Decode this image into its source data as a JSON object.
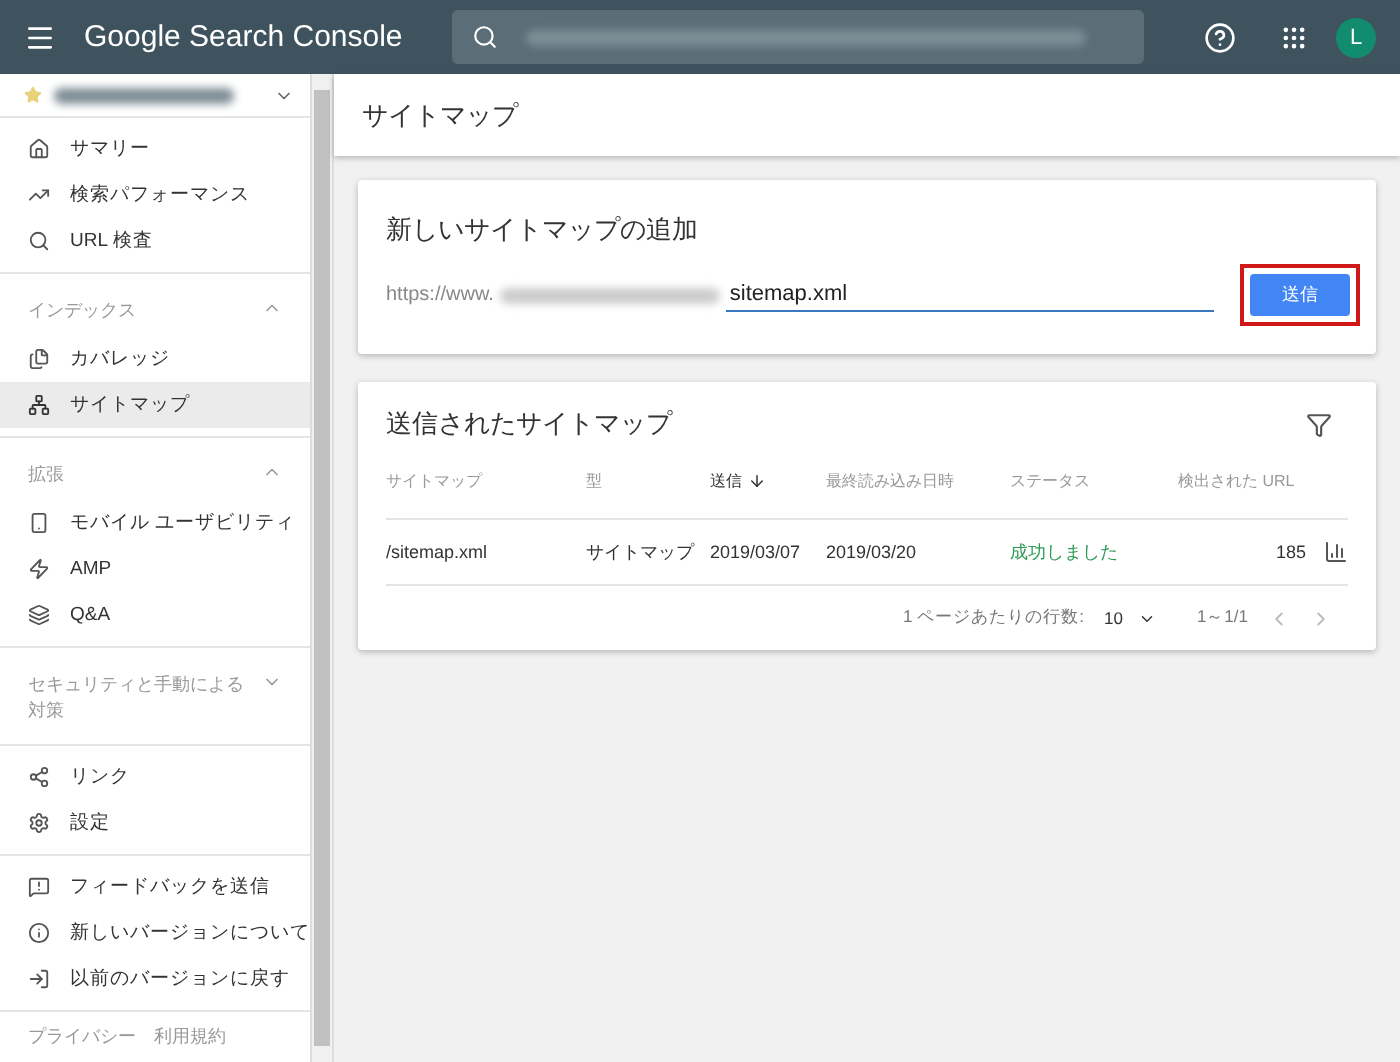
{
  "header": {
    "product": "Google Search Console",
    "avatar_letter": "L"
  },
  "page_title": "サイトマップ",
  "sidebar": {
    "groups": [
      {
        "items": [
          {
            "label": "サマリー",
            "selected": false
          },
          {
            "label": "検索パフォーマンス",
            "selected": false
          },
          {
            "label": "URL 検査",
            "selected": false
          }
        ]
      },
      {
        "title": "インデックス",
        "expanded": true,
        "items": [
          {
            "label": "カバレッジ",
            "selected": false
          },
          {
            "label": "サイトマップ",
            "selected": true
          }
        ]
      },
      {
        "title": "拡張",
        "expanded": true,
        "items": [
          {
            "label": "モバイル ユーザビリティ",
            "selected": false
          },
          {
            "label": "AMP",
            "selected": false
          },
          {
            "label": "Q&A",
            "selected": false
          }
        ]
      },
      {
        "title": "セキュリティと手動による対策",
        "expanded": false
      },
      {
        "items": [
          {
            "label": "リンク",
            "selected": false
          },
          {
            "label": "設定",
            "selected": false
          }
        ]
      },
      {
        "items": [
          {
            "label": "フィードバックを送信",
            "selected": false
          },
          {
            "label": "新しいバージョンについて",
            "selected": false
          },
          {
            "label": "以前のバージョンに戻す",
            "selected": false
          }
        ]
      }
    ],
    "footer": "プライバシー　利用規約"
  },
  "add_card": {
    "title": "新しいサイトマップの追加",
    "url_prefix": "https://www.",
    "value": "sitemap.xml",
    "submit": "送信"
  },
  "list_card": {
    "title": "送信されたサイトマップ",
    "columns": [
      {
        "label": "サイトマップ",
        "sorted": false
      },
      {
        "label": "型",
        "sorted": false
      },
      {
        "label": "送信",
        "sorted": true
      },
      {
        "label": "最終読み込み日時",
        "sorted": false
      },
      {
        "label": "ステータス",
        "sorted": false
      },
      {
        "label": "検出された URL",
        "sorted": false
      }
    ],
    "rows": [
      {
        "sitemap": "/sitemap.xml",
        "type": "サイトマップ",
        "submitted": "2019/03/07",
        "last_read": "2019/03/20",
        "status": "成功しました",
        "urls": "185"
      }
    ],
    "rows_per_page_label": "1 ページあたりの行数:",
    "rows_per_page": "10",
    "range": "1～1/1"
  }
}
